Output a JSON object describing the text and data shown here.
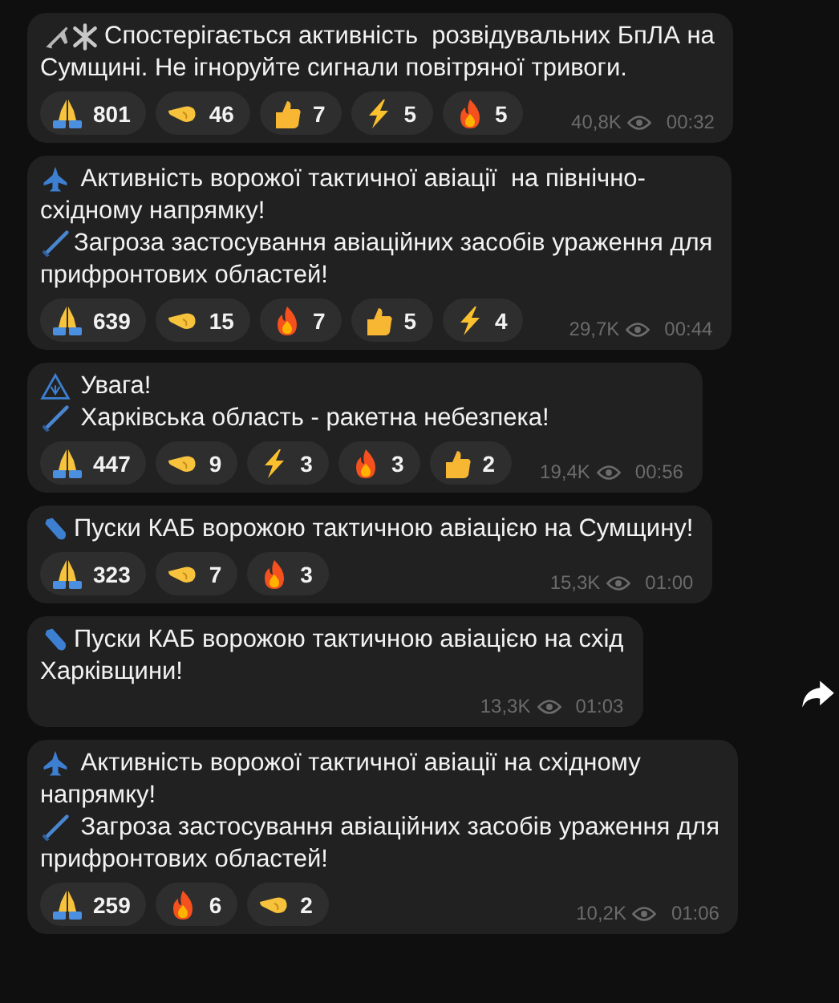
{
  "messages": [
    {
      "paragraphs": [
        {
          "kind": "planes",
          "lines": [
            "Спостерігається активність  розвідувальних БпЛА на",
            "Сумщині. Не ігноруйте сигнали повітряної тривоги."
          ]
        }
      ],
      "reactions": [
        {
          "kind": "pray",
          "count": "801"
        },
        {
          "kind": "point",
          "count": "46"
        },
        {
          "kind": "thumb",
          "count": "7"
        },
        {
          "kind": "bolt",
          "count": "5"
        },
        {
          "kind": "fire",
          "count": "5"
        }
      ],
      "views": "40,8K",
      "time": "00:32"
    },
    {
      "paragraphs": [
        {
          "kind": "jet",
          "lines": [
            " Активність ворожої тактичної авіації  на північно-",
            "східному напрямку!"
          ]
        },
        {
          "kind": "missile",
          "lines": [
            "Загроза застосування авіаційних засобів ураження для",
            "прифронтових областей!"
          ]
        }
      ],
      "reactions": [
        {
          "kind": "pray",
          "count": "639"
        },
        {
          "kind": "point",
          "count": "15"
        },
        {
          "kind": "fire",
          "count": "7"
        },
        {
          "kind": "thumb",
          "count": "5"
        },
        {
          "kind": "bolt",
          "count": "4"
        }
      ],
      "views": "29,7K",
      "time": "00:44"
    },
    {
      "paragraphs": [
        {
          "kind": "warning",
          "lines": [
            " Увага!"
          ]
        },
        {
          "kind": "missile",
          "lines": [
            " Харківська область - ракетна небезпека!"
          ]
        }
      ],
      "reactions": [
        {
          "kind": "pray",
          "count": "447"
        },
        {
          "kind": "point",
          "count": "9"
        },
        {
          "kind": "bolt",
          "count": "3"
        },
        {
          "kind": "fire",
          "count": "3"
        },
        {
          "kind": "thumb",
          "count": "2"
        }
      ],
      "views": "19,4K",
      "time": "00:56"
    },
    {
      "paragraphs": [
        {
          "kind": "bomb",
          "lines": [
            "Пуски КАБ ворожою тактичною авіацією на Сумщину!"
          ]
        }
      ],
      "reactions": [
        {
          "kind": "pray",
          "count": "323"
        },
        {
          "kind": "point",
          "count": "7"
        },
        {
          "kind": "fire",
          "count": "3"
        }
      ],
      "views": "15,3K",
      "time": "01:00"
    },
    {
      "paragraphs": [
        {
          "kind": "bomb",
          "lines": [
            "Пуски КАБ ворожою тактичною авіацією на схід",
            "Харківщини!"
          ]
        }
      ],
      "views": "13,3K",
      "time": "01:03",
      "forward_button": true
    },
    {
      "paragraphs": [
        {
          "kind": "jet",
          "lines": [
            " Активність ворожої тактичної авіації на східному",
            "напрямку!"
          ]
        },
        {
          "kind": "missile",
          "lines": [
            " Загроза застосування авіаційних засобів ураження для",
            "прифронтових областей!"
          ]
        }
      ],
      "reactions": [
        {
          "kind": "pray",
          "count": "259"
        },
        {
          "kind": "fire",
          "count": "6"
        },
        {
          "kind": "point",
          "count": "2"
        }
      ],
      "views": "10,2K",
      "time": "01:06"
    }
  ]
}
